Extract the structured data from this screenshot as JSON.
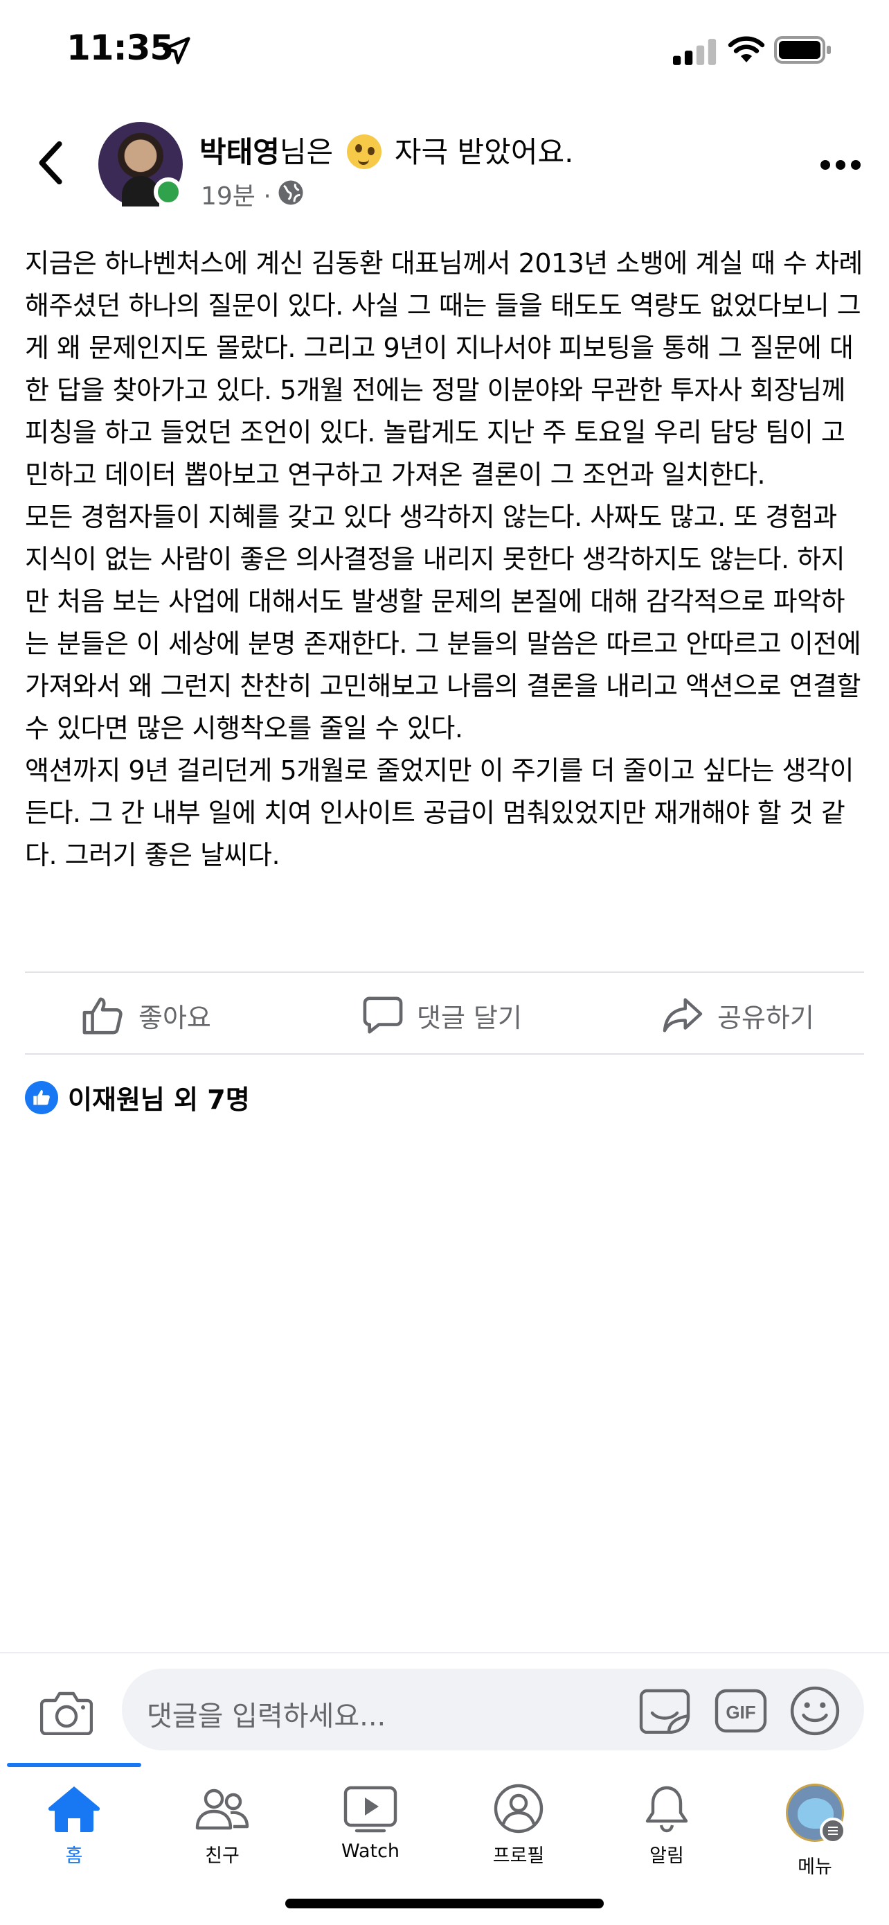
{
  "status_bar": {
    "time": "11:35"
  },
  "post": {
    "author": "박태영",
    "action_text": "님은 ",
    "action_suffix": " 자극 받았어요.",
    "timestamp": "19분",
    "separator": "·",
    "paragraphs": [
      "지금은 하나벤처스에 계신 김동환 대표님께서 2013년 소뱅에 계실 때 수 차례 해주셨던 하나의 질문이 있다. 사실 그 때는 들을 태도도 역량도 없었다보니 그게 왜 문제인지도 몰랐다. 그리고 9년이 지나서야 피보팅을 통해 그 질문에 대한 답을 찾아가고 있다. 5개월 전에는 정말 이분야와 무관한 투자사 회장님께 피칭을 하고 들었던 조언이 있다. 놀랍게도 지난 주 토요일 우리 담당 팀이 고민하고 데이터 뽑아보고 연구하고 가져온 결론이 그 조언과 일치한다.",
      "모든 경험자들이 지혜를 갖고 있다 생각하지 않는다. 사짜도 많고. 또 경험과 지식이 없는 사람이 좋은 의사결정을 내리지 못한다 생각하지도 않는다. 하지만 처음 보는 사업에 대해서도 발생할 문제의 본질에 대해 감각적으로 파악하는 분들은 이 세상에 분명 존재한다. 그 분들의 말씀은 따르고 안따르고 이전에 가져와서 왜 그런지 찬찬히 고민해보고 나름의 결론을 내리고 액션으로 연결할 수 있다면 많은 시행착오를 줄일 수 있다.",
      "액션까지 9년 걸리던게 5개월로 줄었지만 이 주기를 더 줄이고 싶다는 생각이 든다. 그 간 내부 일에 치여 인사이트 공급이 멈춰있었지만 재개해야 할 것 같다. 그러기 좋은 날씨다."
    ],
    "actions": {
      "like": "좋아요",
      "comment": "댓글 달기",
      "share": "공유하기"
    },
    "reactions": "이재원님 외 7명"
  },
  "comment_bar": {
    "placeholder": "댓글을 입력하세요...",
    "gif_label": "GIF"
  },
  "tabs": [
    {
      "label": "홈",
      "icon": "home-icon",
      "active": true
    },
    {
      "label": "친구",
      "icon": "friends-icon"
    },
    {
      "label": "Watch",
      "icon": "watch-icon"
    },
    {
      "label": "프로필",
      "icon": "profile-icon"
    },
    {
      "label": "알림",
      "icon": "bell-icon"
    },
    {
      "label": "메뉴",
      "icon": "menu-icon"
    }
  ],
  "colors": {
    "accent": "#1877f2",
    "secondary_text": "#65676b",
    "online": "#31a24c"
  }
}
